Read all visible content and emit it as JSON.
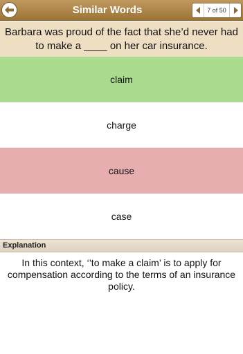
{
  "header": {
    "title": "Similar Words",
    "back_icon": "back-arrow-icon",
    "pager": {
      "count": "7 of 50"
    }
  },
  "question": {
    "text": "Barbara was proud of the fact that she’d never had to make a ____ on her car insurance."
  },
  "options": [
    {
      "label": "claim",
      "state": "correct",
      "color": "#abdb8e"
    },
    {
      "label": "charge",
      "state": "neutral",
      "color": "#ffffff"
    },
    {
      "label": "cause",
      "state": "wrong",
      "color": "#e6aeae"
    },
    {
      "label": "case",
      "state": "neutral",
      "color": "#ffffff"
    }
  ],
  "explanation": {
    "heading": "Explanation",
    "text": "In this context, ‘’to make a claim’ is to apply for compensation according to the terms of an insurance policy."
  },
  "colors": {
    "header": "#a98044",
    "question_bg": "#efdfc2",
    "correct": "#abdb8e",
    "wrong": "#e6aeae"
  }
}
